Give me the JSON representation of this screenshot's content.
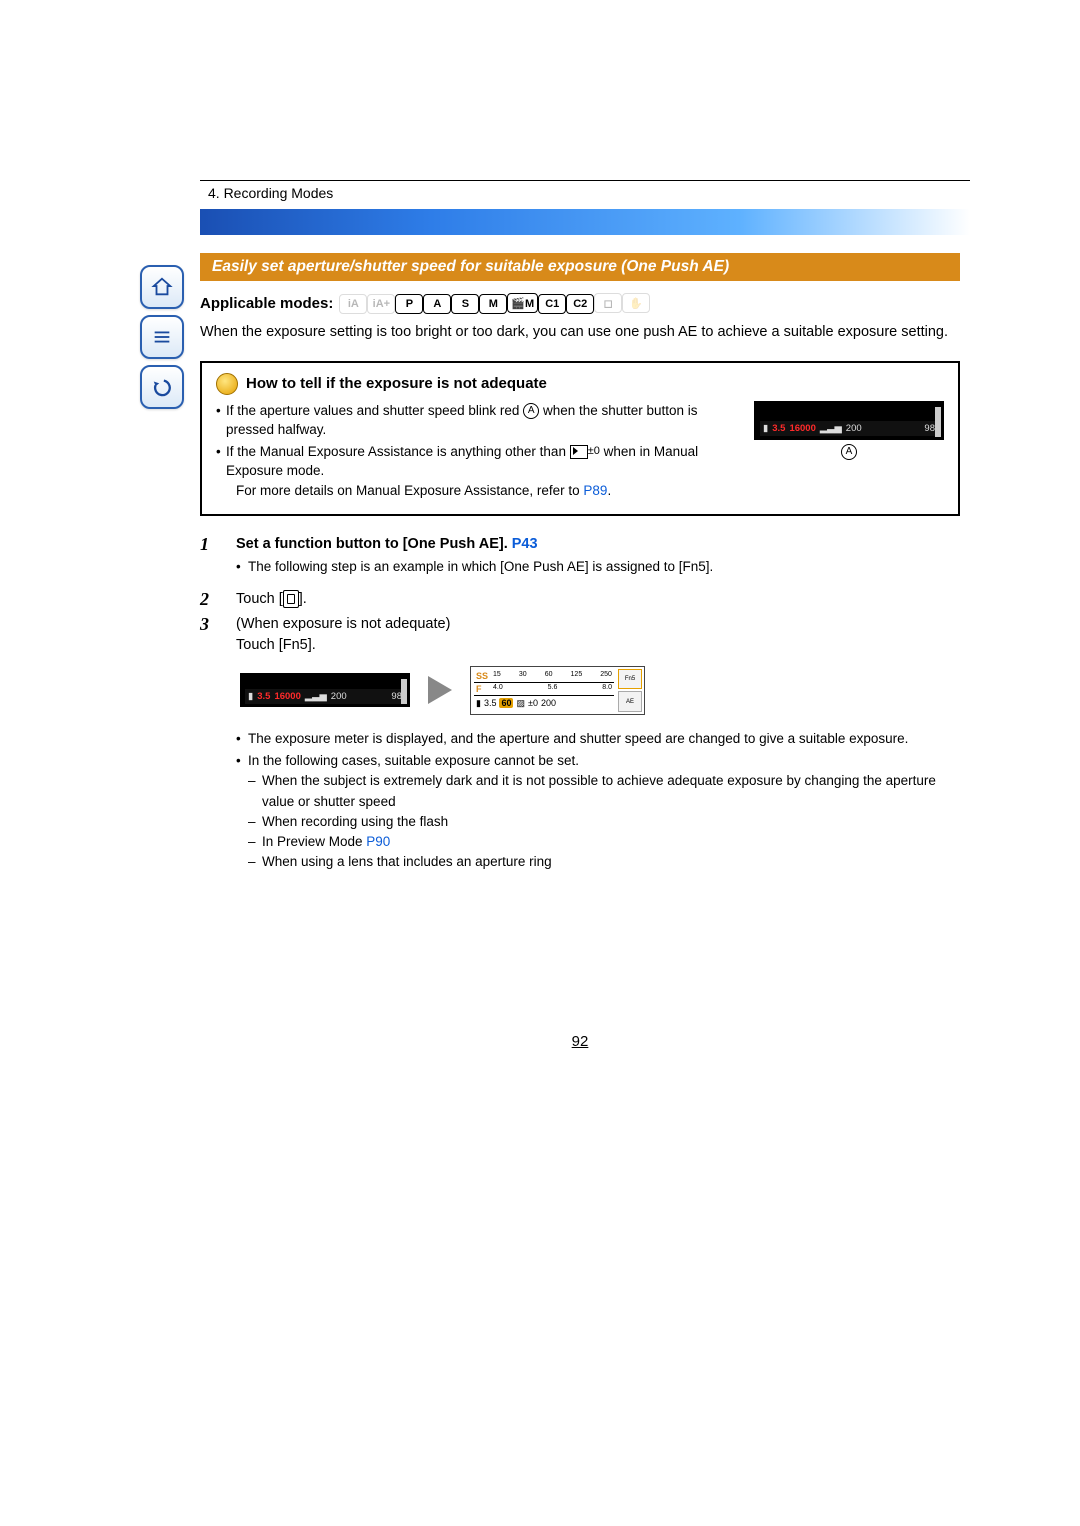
{
  "header": {
    "breadcrumb": "4. Recording Modes"
  },
  "section": {
    "title": "Easily set aperture/shutter speed for suitable exposure (One Push AE)",
    "applicable_label": "Applicable modes:"
  },
  "modes": [
    "iA",
    "iA+",
    "P",
    "A",
    "S",
    "M",
    "🎬M",
    "C1",
    "C2",
    "◻",
    "✋"
  ],
  "modes_dim": [
    true,
    true,
    false,
    false,
    false,
    false,
    false,
    false,
    false,
    true,
    true
  ],
  "intro": "When the exposure setting is too bright or too dark, you can use one push AE to achieve a suitable exposure setting.",
  "tip": {
    "title": "How to tell if the exposure is not adequate",
    "b1a": "If the aperture values and shutter speed blink red ",
    "b1b": " when the shutter button is pressed halfway.",
    "b2a": "If the Manual Exposure Assistance is anything other than ",
    "b2b": " when in Manual Exposure mode.",
    "b3": "For more details on Manual Exposure Assistance, refer to ",
    "link": "P89",
    "circledA": "A",
    "mea_text": "±0"
  },
  "lcd1": {
    "aperture": "3.5",
    "shutter": "16000",
    "iso": "200",
    "count": "98",
    "label": "A"
  },
  "steps": {
    "s1a": "Set a function button to [One Push AE]. ",
    "s1link": "P43",
    "s1_note": "The following step is an example in which [One Push AE] is assigned to [Fn5].",
    "s2a": "Touch [",
    "s2b": "].",
    "s3a": "(When exposure is not adequate)",
    "s3b": "Touch [Fn5]."
  },
  "lcd_left": {
    "aperture": "3.5",
    "shutter": "16000",
    "iso": "200",
    "count": "98"
  },
  "lcd_right": {
    "ss_label": "SS",
    "f_label": "F",
    "ss_ticks": [
      "15",
      "30",
      "60",
      "125",
      "250"
    ],
    "f_ticks": [
      "4.0",
      "5.6",
      "8.0"
    ],
    "aperture": "3.5",
    "shutter": "60",
    "ev": "±0",
    "iso": "200",
    "side": [
      "Fn5",
      "AE"
    ]
  },
  "notes": {
    "n1": "The exposure meter is displayed, and the aperture and shutter speed are changed to give a suitable exposure.",
    "n2": "In the following cases, suitable exposure cannot be set.",
    "d1": "When the subject is extremely dark and it is not possible to achieve adequate exposure by changing the aperture value or shutter speed",
    "d2": "When recording using the flash",
    "d3a": "In Preview Mode ",
    "d3link": "P90",
    "d4": "When using a lens that includes an aperture ring"
  },
  "page_number": "92"
}
